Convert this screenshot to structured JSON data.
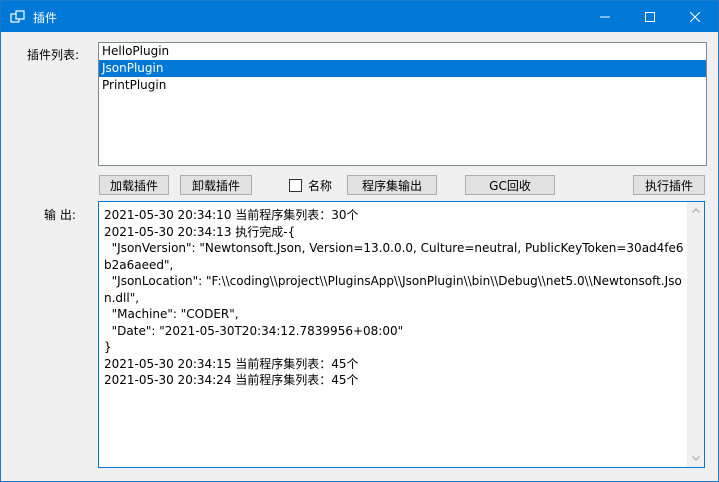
{
  "window": {
    "title": "插件"
  },
  "labels": {
    "plugin_list": "插件列表:",
    "output": "输  出:"
  },
  "plugins": [
    {
      "label": "HelloPlugin"
    },
    {
      "label": "JsonPlugin",
      "selected": true
    },
    {
      "label": "PrintPlugin"
    }
  ],
  "buttons": {
    "load": "加载插件",
    "unload": "卸载插件",
    "name_checkbox": "名称",
    "assembly_output": "程序集输出",
    "gc": "GC回收",
    "execute": "执行插件"
  },
  "output_text": "2021-05-30 20:34:10 当前程序集列表：30个\n2021-05-30 20:34:13 执行完成-{\n  \"JsonVersion\": \"Newtonsoft.Json, Version=13.0.0.0, Culture=neutral, PublicKeyToken=30ad4fe6b2a6aeed\",\n  \"JsonLocation\": \"F:\\\\coding\\\\project\\\\PluginsApp\\\\JsonPlugin\\\\bin\\\\Debug\\\\net5.0\\\\Newtonsoft.Json.dll\",\n  \"Machine\": \"CODER\",\n  \"Date\": \"2021-05-30T20:34:12.7839956+08:00\"\n}\n2021-05-30 20:34:15 当前程序集列表：45个\n2021-05-30 20:34:24 当前程序集列表：45个",
  "colors": {
    "titlebar": "#0078d7",
    "selection": "#0078d7"
  },
  "icons": [
    "app-icon",
    "minimize-icon",
    "maximize-icon",
    "close-icon",
    "scroll-up-icon",
    "scroll-down-icon"
  ]
}
